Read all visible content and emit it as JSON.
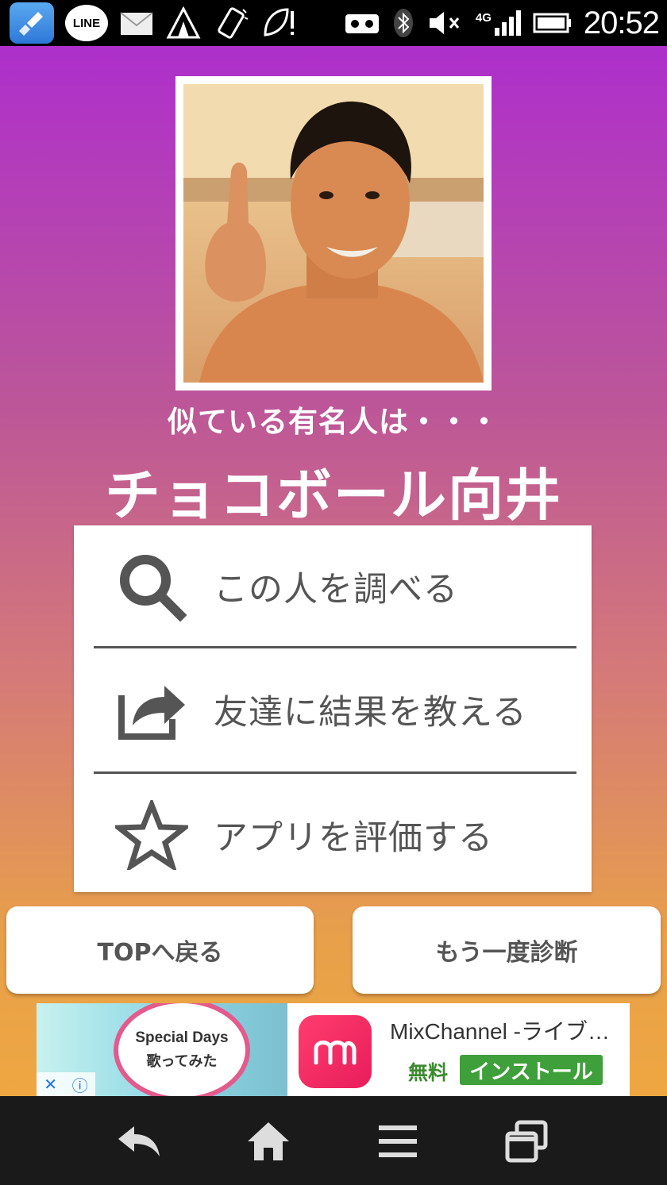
{
  "status_bar": {
    "time": "20:52",
    "line_label": "LINE",
    "network_label": "4G",
    "icons_left": [
      "cleaner-app-icon",
      "line-app-icon",
      "mail-icon",
      "camp-tent-icon",
      "phone-vibrate-icon",
      "leaf-notice-icon"
    ],
    "icons_right": [
      "vr-icon",
      "bluetooth-icon",
      "mute-icon",
      "signal-4g-icon",
      "battery-icon"
    ]
  },
  "result": {
    "subtitle": "似ている有名人は・・・",
    "celebrity_name": "チョコボール向井"
  },
  "menu": {
    "items": [
      {
        "icon": "search-icon",
        "label": "この人を調べる"
      },
      {
        "icon": "share-icon",
        "label": "友達に結果を教える"
      },
      {
        "icon": "star-icon",
        "label": "アプリを評価する"
      }
    ]
  },
  "buttons": {
    "back_top": "TOPへ戻る",
    "retry": "もう一度診断"
  },
  "ad": {
    "thumb_line1": "Special Days",
    "thumb_line2": "歌ってみた",
    "title": "MixChannel -ライブ…",
    "price": "無料",
    "install": "インストール",
    "close_symbol": "✕",
    "info_symbol": "ⓘ"
  },
  "nav_bar": {
    "icons": [
      "back-icon",
      "home-icon",
      "menu-icon",
      "recent-apps-icon"
    ]
  },
  "colors": {
    "gradient_top": "#ae2fcc",
    "gradient_bottom": "#eea741",
    "menu_text": "#555555",
    "install_green": "#3f9f3a"
  }
}
